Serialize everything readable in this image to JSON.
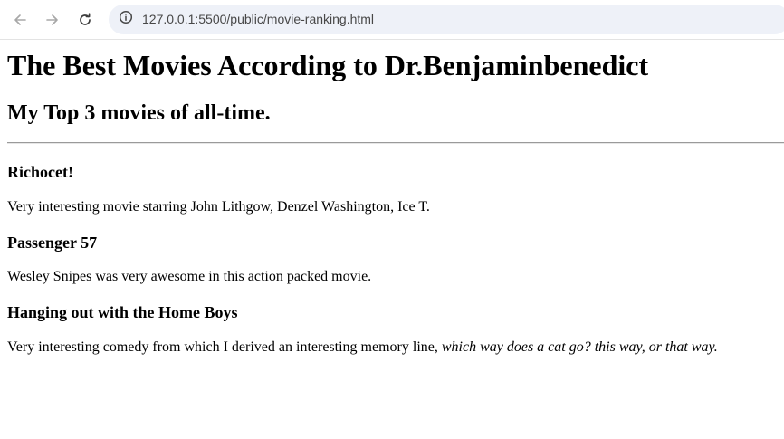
{
  "browser": {
    "url": "127.0.0.1:5500/public/movie-ranking.html"
  },
  "page": {
    "title": "The Best Movies According to Dr.Benjaminbenedict",
    "subtitle": "My Top 3 movies of all-time.",
    "movies": [
      {
        "title": "Richocet!",
        "description": "Very interesting movie starring John Lithgow, Denzel Washington, Ice T."
      },
      {
        "title": "Passenger 57",
        "description": "Wesley Snipes was very awesome in this action packed movie."
      },
      {
        "title": "Hanging out with the Home Boys",
        "description": "Very interesting comedy from which I derived an interesting memory line, ",
        "description_italic": "which way does a cat go? this way, or that way."
      }
    ]
  }
}
